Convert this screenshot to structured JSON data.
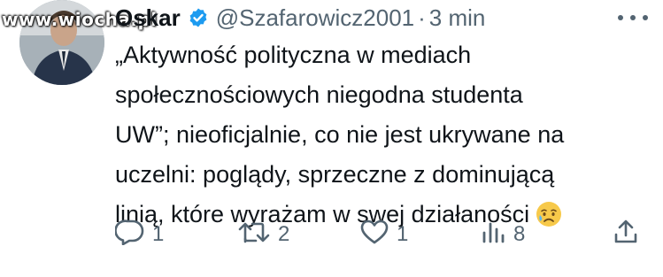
{
  "watermark": "www.wiocha.pl",
  "author": {
    "name": "Oskar",
    "handle": "@Szafarowicz2001",
    "separator": "·",
    "time": "3 min"
  },
  "icons": {
    "avatar": "profile-photo",
    "verified": "verified-badge-icon",
    "more": "more-icon",
    "emoji": "sad-but-relieved-face-emoji",
    "reply": "reply-icon",
    "retweet": "retweet-icon",
    "like": "heart-icon",
    "views": "views-bar-chart-icon",
    "share": "share-icon"
  },
  "text_lines": [
    "„Aktywność polityczna w mediach",
    "społecznościowych niegodna studenta",
    "UW”; nieoficjalnie, co nie jest ukrywane na",
    "uczelni: poglądy, sprzeczne z dominującą",
    "linią, które wyrażam w swej działaności"
  ],
  "stats": {
    "replies": "1",
    "retweets": "2",
    "likes": "1",
    "views": "8"
  },
  "colors": {
    "text": "#0f1419",
    "secondary": "#536471",
    "verified": "#1d9bf0"
  }
}
